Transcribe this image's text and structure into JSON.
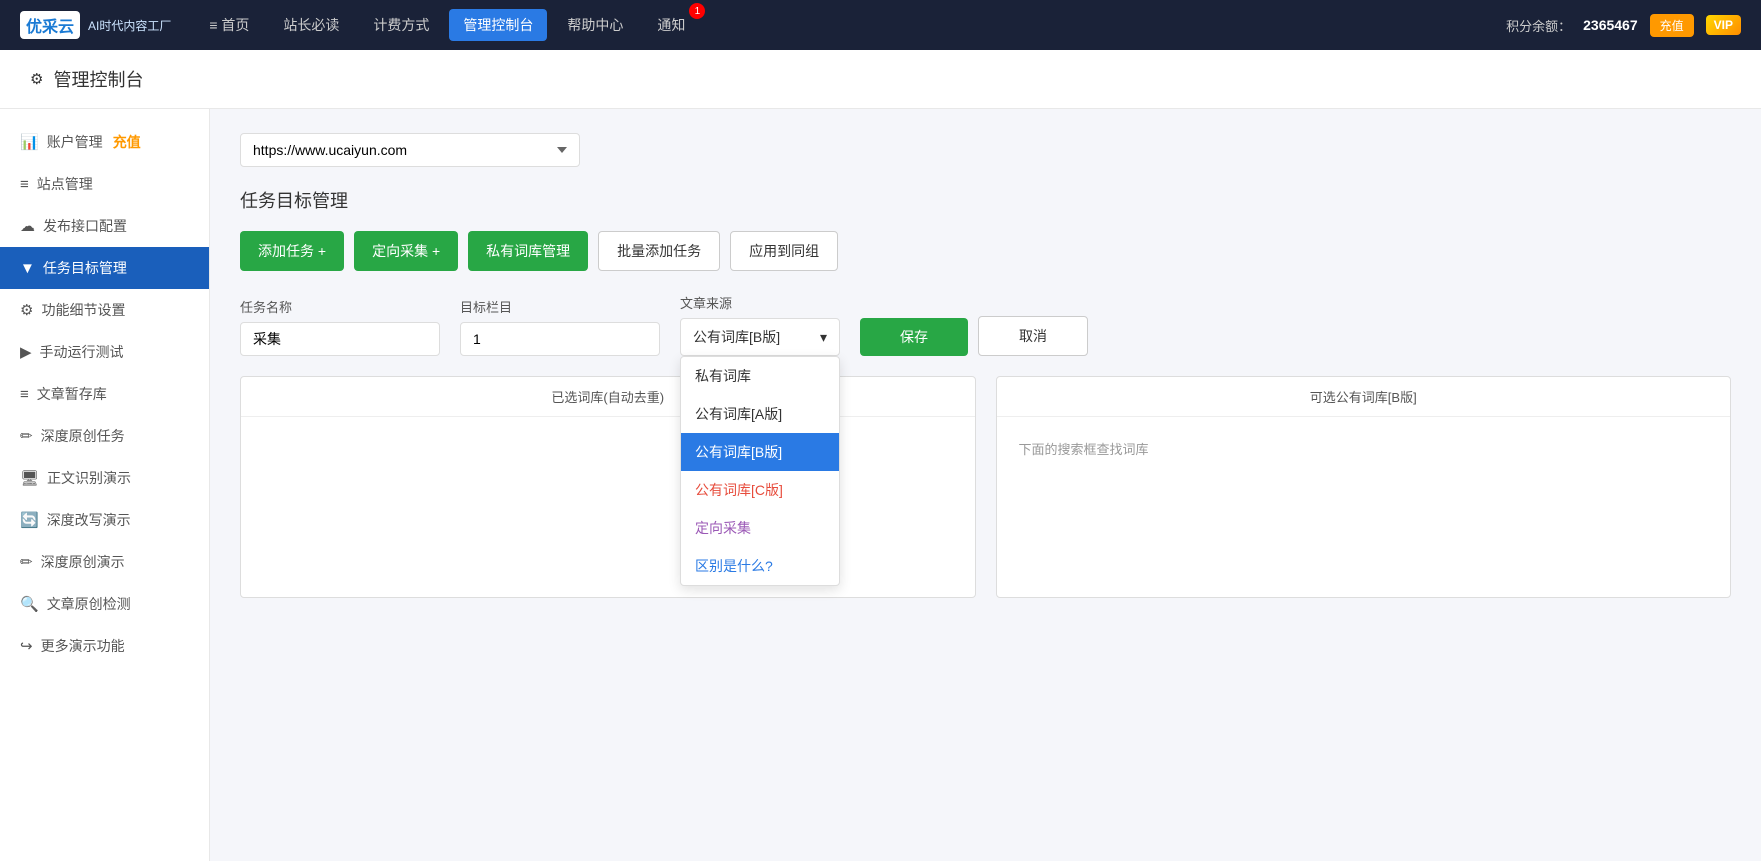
{
  "topnav": {
    "logo_abbr": "优采云",
    "logo_sub": "AI时代内容工厂",
    "nav_items": [
      {
        "label": "≡ 首页",
        "active": false
      },
      {
        "label": "站长必读",
        "active": false
      },
      {
        "label": "计费方式",
        "active": false
      },
      {
        "label": "管理控制台",
        "active": true
      },
      {
        "label": "帮助中心",
        "active": false
      },
      {
        "label": "通知",
        "active": false
      }
    ],
    "notif_count": "1",
    "points_label": "积分余额：",
    "points_value": "2365467",
    "recharge_btn": "充值",
    "vip_label": "VIP"
  },
  "page_header": {
    "icon": "⚙",
    "title": "管理控制台"
  },
  "sidebar": {
    "items": [
      {
        "icon": "📊",
        "label": "账户管理",
        "recharge": "充值",
        "active": false
      },
      {
        "icon": "≡",
        "label": "站点管理",
        "active": false
      },
      {
        "icon": "☁",
        "label": "发布接口配置",
        "active": false
      },
      {
        "icon": "▼",
        "label": "任务目标管理",
        "active": true
      },
      {
        "icon": "⚙",
        "label": "功能细节设置",
        "active": false
      },
      {
        "icon": "▶",
        "label": "手动运行测试",
        "active": false
      },
      {
        "icon": "≡",
        "label": "文章暂存库",
        "active": false
      },
      {
        "icon": "✏",
        "label": "深度原创任务",
        "active": false
      },
      {
        "icon": "🖥",
        "label": "正文识别演示",
        "active": false
      },
      {
        "icon": "🔄",
        "label": "深度改写演示",
        "active": false
      },
      {
        "icon": "✏",
        "label": "深度原创演示",
        "active": false
      },
      {
        "icon": "🔍",
        "label": "文章原创检测",
        "active": false
      },
      {
        "icon": "↪",
        "label": "更多演示功能",
        "active": false
      }
    ]
  },
  "main": {
    "site_url": "https://www.ucaiyun.com",
    "section_title": "任务目标管理",
    "buttons": {
      "add_task": "添加任务 +",
      "directed_collect": "定向采集 +",
      "private_library": "私有词库管理",
      "batch_add": "批量添加任务",
      "apply_group": "应用到同组"
    },
    "form": {
      "task_name_label": "任务名称",
      "task_name_value": "采集",
      "target_col_label": "目标栏目",
      "target_col_value": "1",
      "source_label": "文章来源",
      "source_selected": "公有词库[B版]",
      "source_options": [
        {
          "label": "私有词库",
          "style": "normal"
        },
        {
          "label": "公有词库[A版]",
          "style": "normal"
        },
        {
          "label": "公有词库[B版]",
          "style": "selected-blue"
        },
        {
          "label": "公有词库[C版]",
          "style": "color-red"
        },
        {
          "label": "定向采集",
          "style": "color-purple"
        },
        {
          "label": "区别是什么?",
          "style": "color-link"
        }
      ],
      "save_btn": "保存",
      "cancel_btn": "取消"
    },
    "wordpool": {
      "left_header": "已选词库(自动去重)",
      "right_header": "可选公有词库[B版]",
      "right_hint": "下面的搜索框查找词库"
    }
  }
}
